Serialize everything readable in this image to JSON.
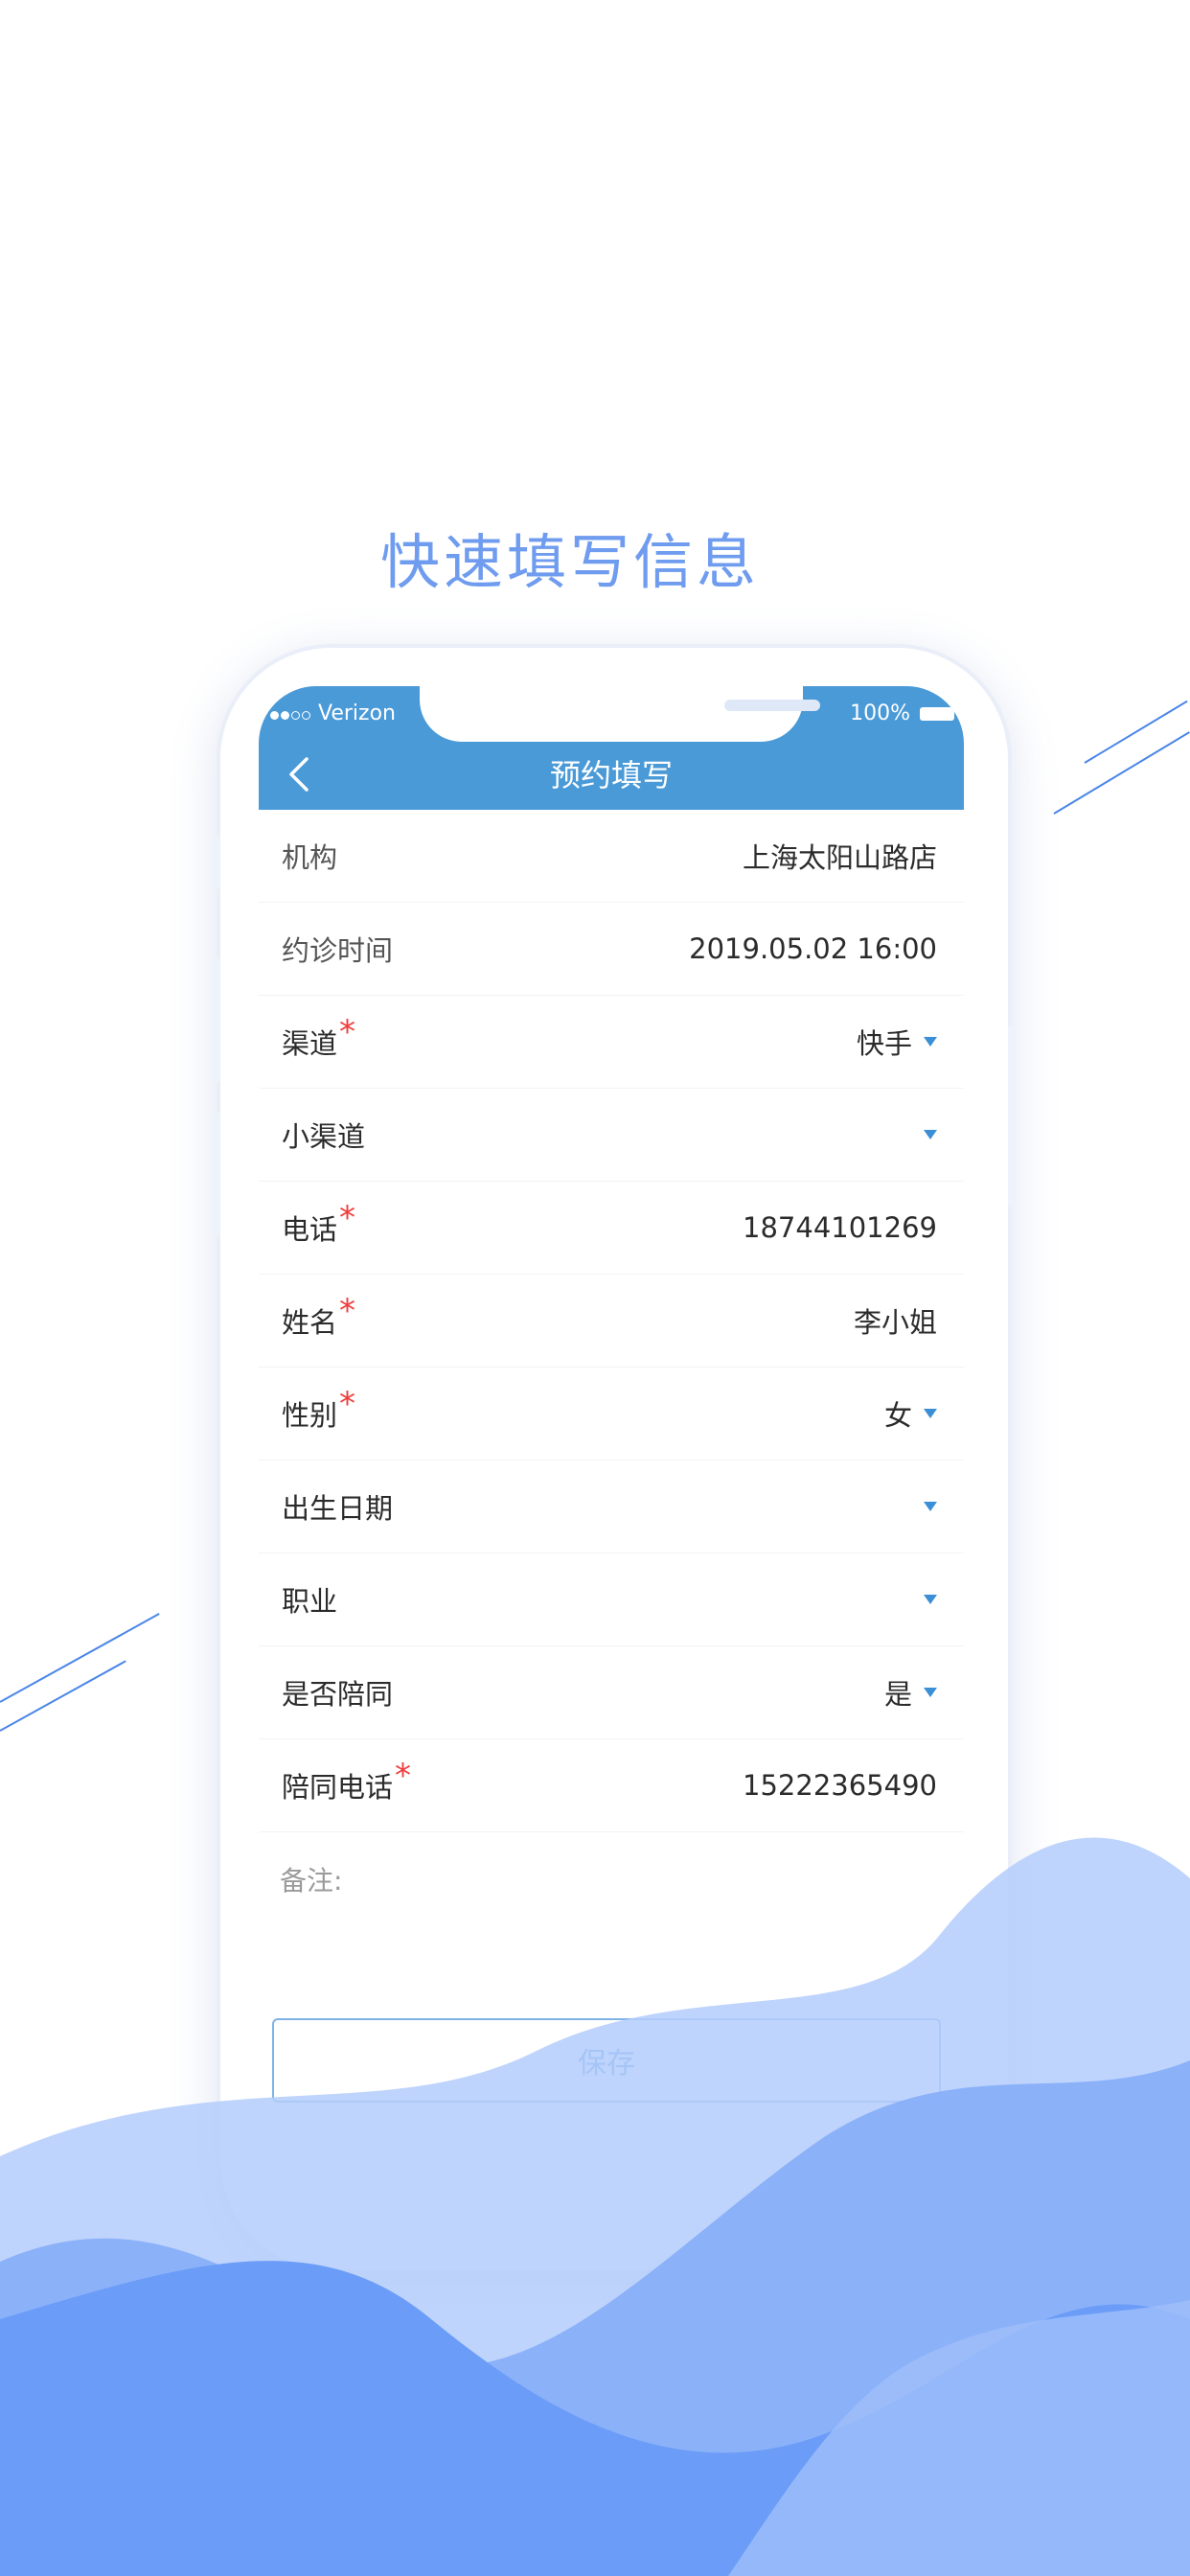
{
  "headline": "快速填写信息",
  "status_bar": {
    "carrier": "Verizon",
    "battery": "100%"
  },
  "nav": {
    "title": "预约填写",
    "back_icon": "chevron-left-icon"
  },
  "form": {
    "rows": [
      {
        "label": "机构",
        "value": "上海太阳山路店",
        "required": false,
        "dropdown": false
      },
      {
        "label": "约诊时间",
        "value": "2019.05.02  16:00",
        "required": false,
        "dropdown": false
      },
      {
        "label": "渠道",
        "value": "快手",
        "required": true,
        "dropdown": true
      },
      {
        "label": "小渠道",
        "value": "",
        "required": false,
        "dropdown": true
      },
      {
        "label": "电话",
        "value": "18744101269",
        "required": true,
        "dropdown": false
      },
      {
        "label": "姓名",
        "value": "李小姐",
        "required": true,
        "dropdown": false
      },
      {
        "label": "性别",
        "value": "女",
        "required": true,
        "dropdown": true
      },
      {
        "label": "出生日期",
        "value": "",
        "required": false,
        "dropdown": true
      },
      {
        "label": "职业",
        "value": "",
        "required": false,
        "dropdown": true
      },
      {
        "label": "是否陪同",
        "value": "是",
        "required": false,
        "dropdown": true
      },
      {
        "label": "陪同电话",
        "value": "15222365490",
        "required": true,
        "dropdown": false
      }
    ],
    "required_mark": "*",
    "note_label": "备注:",
    "save_label": "保存"
  },
  "colors": {
    "accent": "#4a9ad8",
    "headline": "#6f9cef",
    "required": "#f03c3c",
    "wave_light": "#a7c4fb",
    "wave_dark": "#6a9cf8"
  }
}
